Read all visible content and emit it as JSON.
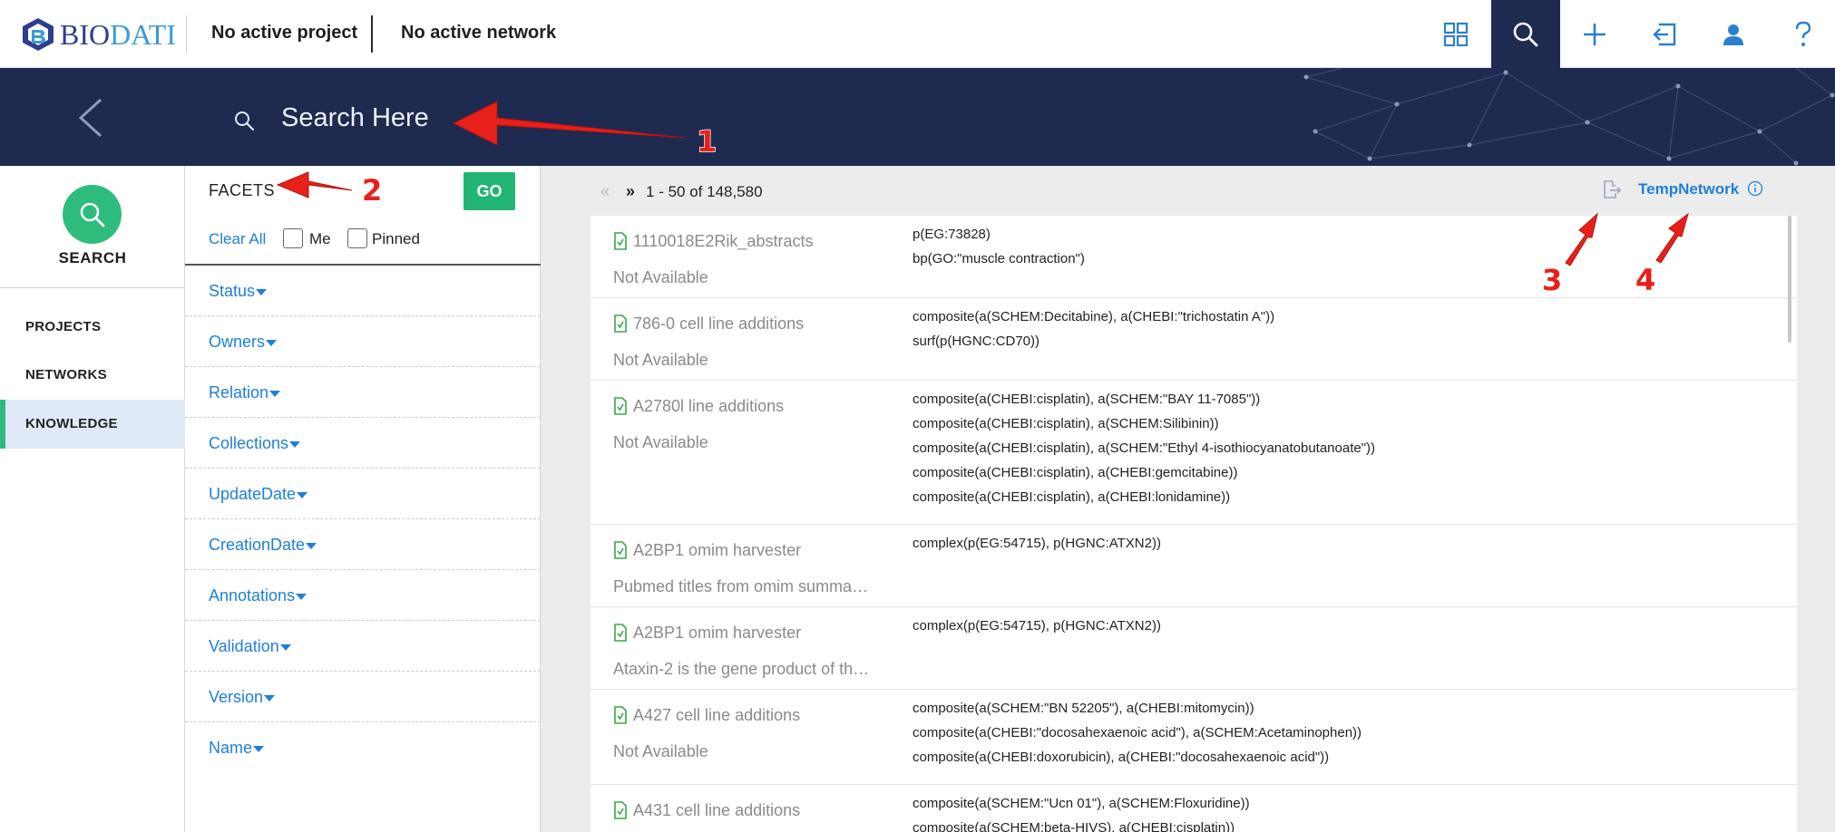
{
  "topbar": {
    "logo_bio": "BIO",
    "logo_dati": "DATI",
    "project": "No active project",
    "network": "No active network",
    "icons": [
      "grid-icon",
      "search-icon",
      "plus-icon",
      "sign-in-icon",
      "user-icon",
      "help-icon"
    ]
  },
  "banner": {
    "search_placeholder": "Search Here"
  },
  "leftnav": {
    "search_label": "SEARCH",
    "items": [
      {
        "label": "PROJECTS"
      },
      {
        "label": "NETWORKS"
      },
      {
        "label": "KNOWLEDGE",
        "active": true
      }
    ]
  },
  "facets": {
    "title": "FACETS",
    "go_label": "GO",
    "clear_all": "Clear All",
    "me_label": "Me",
    "pinned_label": "Pinned",
    "items": [
      {
        "label": "Status"
      },
      {
        "label": "Owners"
      },
      {
        "label": "Relation"
      },
      {
        "label": "Collections"
      },
      {
        "label": "UpdateDate"
      },
      {
        "label": "CreationDate"
      },
      {
        "label": "Annotations"
      },
      {
        "label": "Validation"
      },
      {
        "label": "Version"
      },
      {
        "label": "Name"
      }
    ]
  },
  "results": {
    "prev_symbol": "«",
    "next_symbol": "»",
    "range": "1 - 50 of 148,580",
    "temp_network": "TempNetwork",
    "items": [
      {
        "title": "1110018E2Rik_abstracts",
        "subtitle": "Not Available",
        "statements": [
          "p(EG:73828)",
          "bp(GO:\"muscle contraction\")"
        ]
      },
      {
        "title": "786-0 cell line additions",
        "subtitle": "Not Available",
        "statements": [
          "composite(a(SCHEM:Decitabine), a(CHEBI:\"trichostatin A\"))",
          "surf(p(HGNC:CD70))"
        ]
      },
      {
        "title": "A2780l line additions",
        "subtitle": "Not Available",
        "statements": [
          "composite(a(CHEBI:cisplatin), a(SCHEM:\"BAY 11-7085\"))",
          "composite(a(CHEBI:cisplatin), a(SCHEM:Silibinin))",
          "composite(a(CHEBI:cisplatin), a(SCHEM:\"Ethyl 4-isothiocyanatobutanoate\"))",
          "composite(a(CHEBI:cisplatin), a(CHEBI:gemcitabine))",
          "composite(a(CHEBI:cisplatin), a(CHEBI:lonidamine))"
        ]
      },
      {
        "title": "A2BP1 omim harvester",
        "subtitle": "Pubmed titles from omim summa…",
        "statements": [
          "complex(p(EG:54715), p(HGNC:ATXN2))"
        ]
      },
      {
        "title": "A2BP1 omim harvester",
        "subtitle": "Ataxin-2 is the gene product of th…",
        "statements": [
          "complex(p(EG:54715), p(HGNC:ATXN2))"
        ]
      },
      {
        "title": "A427 cell line additions",
        "subtitle": "Not Available",
        "statements": [
          "composite(a(SCHEM:\"BN 52205\"), a(CHEBI:mitomycin))",
          "composite(a(CHEBI:\"docosahexaenoic acid\"), a(SCHEM:Acetaminophen))",
          "composite(a(CHEBI:doxorubicin), a(CHEBI:\"docosahexaenoic acid\"))"
        ]
      },
      {
        "title": "A431 cell line additions",
        "subtitle": "Not Available",
        "statements": [
          "composite(a(SCHEM:\"Ucn 01\"), a(SCHEM:Floxuridine))",
          "composite(a(SCHEM:beta-HIVS), a(CHEBI:cisplatin))"
        ]
      }
    ]
  },
  "annotations": {
    "labels": [
      "1",
      "2",
      "3",
      "4"
    ],
    "color": "#e8201a"
  },
  "colors": {
    "navy": "#1e2a4f",
    "accent_green": "#2ebc7c",
    "link_blue": "#1f7fd6",
    "doc_green": "#3aa64a"
  }
}
